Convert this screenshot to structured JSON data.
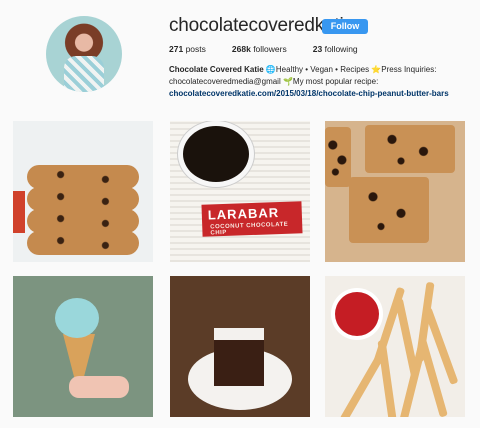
{
  "profile": {
    "username": "chocolatecoveredkatie",
    "follow_label": "Follow",
    "stats": {
      "posts_count": "271",
      "posts_label": "posts",
      "followers_count": "268k",
      "followers_label": "followers",
      "following_count": "23",
      "following_label": "following"
    },
    "bio": {
      "name": "Chocolate Covered Katie",
      "line1_rest": " 🌐Healthy • Vegan • Recipes ⭐Press Inquiries:",
      "line2": "chocolatecoveredmedia@gmail 🌱My most popular recipe:",
      "link": "chocolatecoveredkatie.com/2015/03/18/chocolate-chip-peanut-butter-bars"
    }
  },
  "posts": [
    {
      "icon": "cookie-stack-photo"
    },
    {
      "icon": "coffee-larabar-photo",
      "overlay_text": "LARABAR",
      "overlay_sub": "COCONUT CHOCOLATE CHIP"
    },
    {
      "icon": "blondie-bars-photo"
    },
    {
      "icon": "ice-cream-cone-photo"
    },
    {
      "icon": "chocolate-cake-photo"
    },
    {
      "icon": "fries-ketchup-photo"
    }
  ]
}
